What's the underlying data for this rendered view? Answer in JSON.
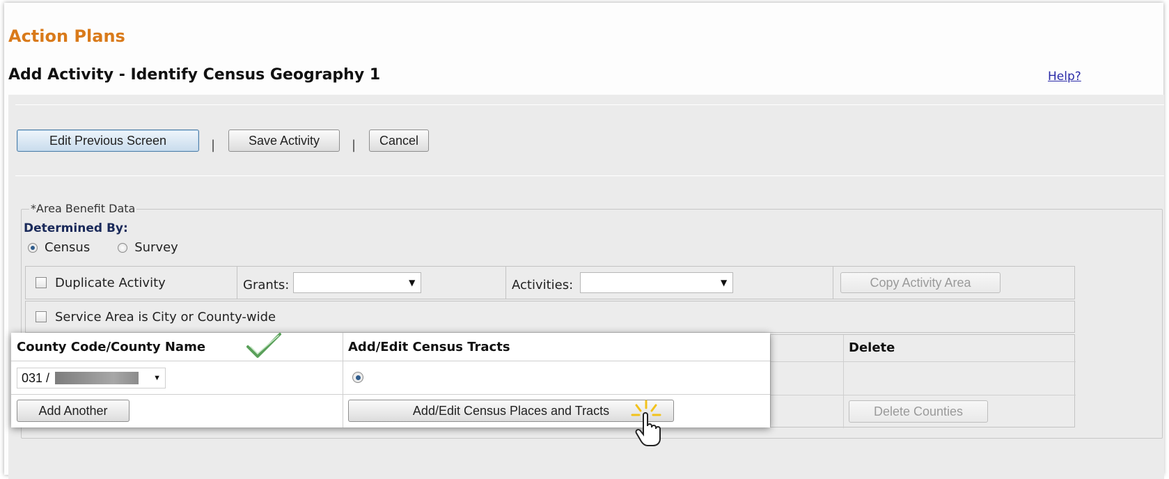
{
  "app": {
    "title": "Action Plans"
  },
  "page": {
    "title": "Add Activity - Identify Census Geography 1",
    "help": "Help?"
  },
  "toolbar": {
    "edit_previous": "Edit Previous Screen",
    "save_activity": "Save Activity",
    "cancel": "Cancel",
    "separator": "|"
  },
  "area_benefit": {
    "legend": "*Area Benefit Data",
    "determined_by_label": "Determined By:",
    "options": [
      {
        "label": "Census",
        "selected": true
      },
      {
        "label": "Survey",
        "selected": false
      }
    ]
  },
  "duplicate": {
    "checkbox_label": "Duplicate Activity",
    "grants_label": "Grants:",
    "grants_value": "",
    "activities_label": "Activities:",
    "activities_value": "",
    "copy_button": "Copy Activity Area"
  },
  "service_area": {
    "checkbox_label": "Service Area is City or County-wide"
  },
  "county_table": {
    "headers": [
      "County Code/County Name",
      "Add/Edit Census Tracts",
      "Delete"
    ],
    "row": {
      "county_value": "031 /",
      "tracts_selected": true
    },
    "add_another": "Add Another",
    "add_edit_places": "Add/Edit Census Places and Tracts",
    "delete_counties": "Delete Counties"
  },
  "colors": {
    "title_orange": "#d97a1a",
    "link_blue": "#2b2ba8",
    "check_green": "#5aa05a"
  },
  "icons": [
    "checkmark-icon",
    "hand-cursor-icon",
    "dropdown-arrow-icon"
  ]
}
